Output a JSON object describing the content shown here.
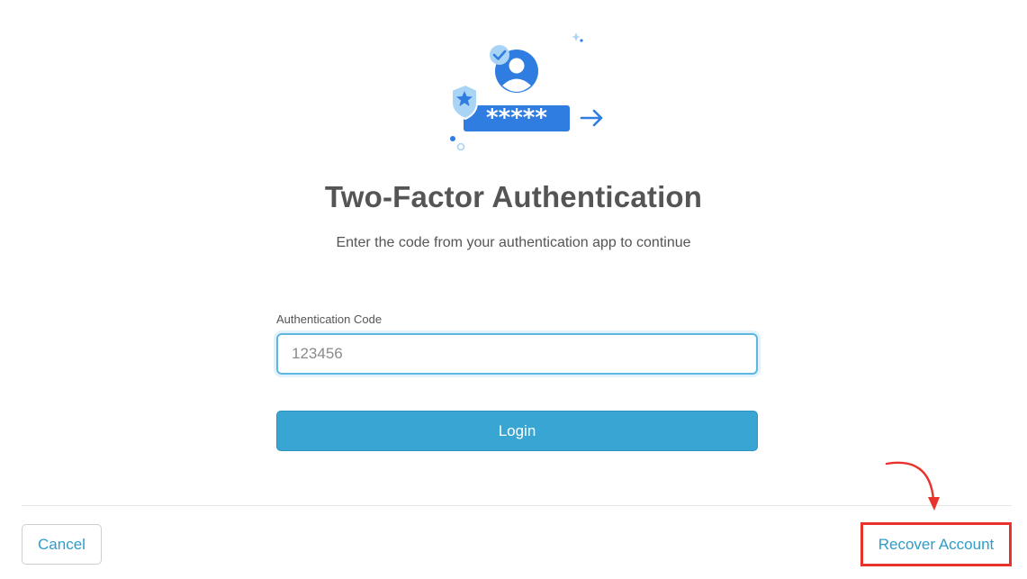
{
  "header": {
    "title": "Two-Factor Authentication",
    "subtitle": "Enter the code from your authentication app to continue"
  },
  "illustration": {
    "icons": [
      "user-avatar-icon",
      "checkmark-badge-icon",
      "star-shield-icon",
      "password-field-icon",
      "arrow-right-icon",
      "sparkle-icon"
    ],
    "password_mask": "*****"
  },
  "form": {
    "code_label": "Authentication Code",
    "code_placeholder": "123456",
    "code_value": "",
    "login_label": "Login"
  },
  "footer": {
    "cancel_label": "Cancel",
    "recover_label": "Recover Account"
  },
  "annotation": {
    "highlight_target": "recover-account-link",
    "color": "#e8322c"
  },
  "colors": {
    "accent": "#38a5d3",
    "link": "#2f9cc9",
    "illustration_blue": "#2f7de1",
    "illustration_light": "#a9d4f5"
  }
}
